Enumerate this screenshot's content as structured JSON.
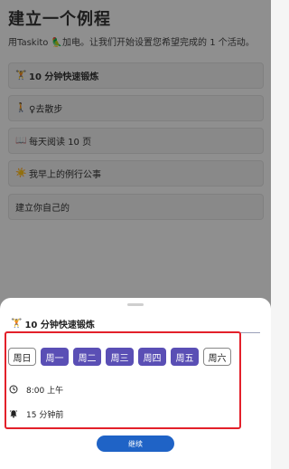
{
  "header": {
    "title": "建立一个例程",
    "subtitle": "用Taskito 🦜加电。让我们开始设置您希望完成的 1 个活动。"
  },
  "routines": [
    {
      "icon": "🏋️",
      "label": "10 分钟快速锻炼",
      "bold": true
    },
    {
      "icon": "🚶",
      "label": "♀去散步",
      "bold": false
    },
    {
      "icon": "📖",
      "label": "每天阅读 10 页",
      "bold": false
    },
    {
      "icon": "☀️",
      "label": "我早上的例行公事",
      "bold": false
    },
    {
      "icon": "",
      "label": "建立你自己的",
      "bold": false
    }
  ],
  "sheet": {
    "icon": "🏋️",
    "title": "10 分钟快速锻炼",
    "days": [
      {
        "label": "周日",
        "selected": false
      },
      {
        "label": "周一",
        "selected": true
      },
      {
        "label": "周二",
        "selected": true
      },
      {
        "label": "周三",
        "selected": true
      },
      {
        "label": "周四",
        "selected": true
      },
      {
        "label": "周五",
        "selected": true
      },
      {
        "label": "周六",
        "selected": false
      }
    ],
    "time": "8:00 上午",
    "reminder": "15 分钟前",
    "continue_label": "继续"
  },
  "colors": {
    "accent": "#5a4fb5",
    "button": "#1f63c6",
    "highlight_border": "#e3202a"
  }
}
